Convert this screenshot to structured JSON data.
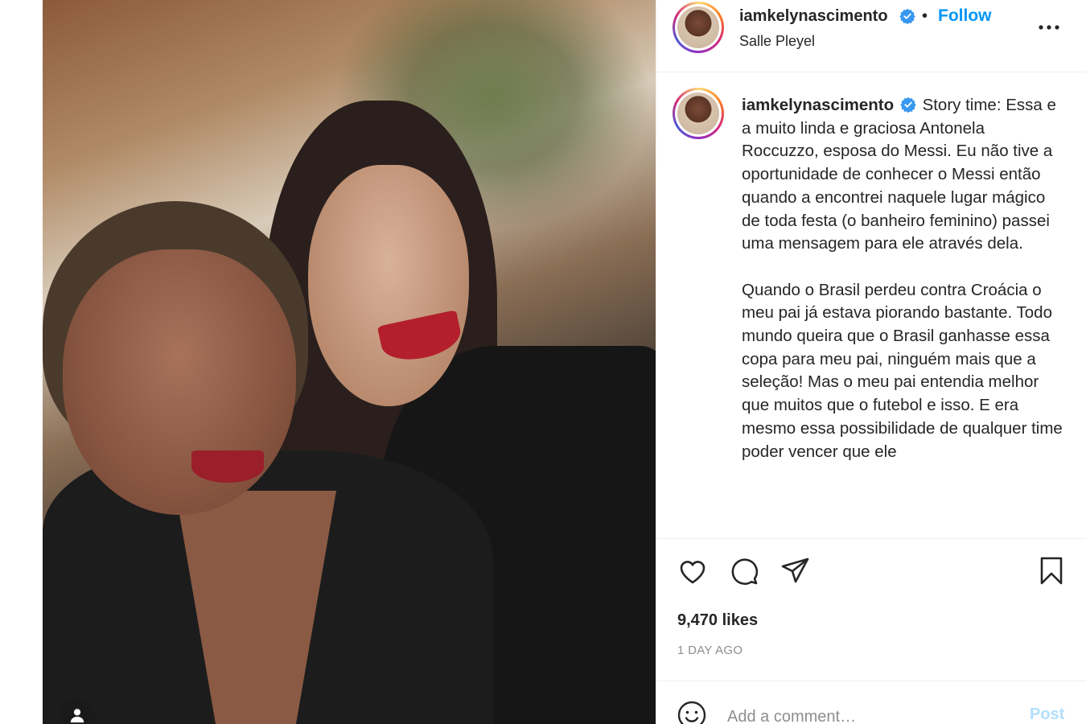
{
  "post": {
    "username": "iamkelynascimento",
    "verified": true,
    "follow_label": "Follow",
    "dot": "•",
    "location": "Salle Pleyel"
  },
  "caption": {
    "username": "iamkelynascimento",
    "paragraph_1": "Story time: Essa e a muito linda e graciosa Antonela Roccuzzo, esposa do Messi. Eu não tive a oportunidade de conhecer o Messi então quando a encontrei naquele lugar mágico de toda festa (o banheiro feminino) passei uma mensagem para ele através dela.",
    "paragraph_2": "Quando o Brasil perdeu contra Croácia o meu pai já estava piorando bastante. Todo mundo queira que o Brasil ganhasse essa copa para meu pai, ninguém mais que a seleção! Mas o meu pai entendia melhor que muitos que o futebol e isso. E era mesmo essa possibilidade de qualquer time poder vencer que ele"
  },
  "actions": {
    "like_icon": "heart-icon",
    "comment_icon": "comment-bubble-icon",
    "share_icon": "paper-plane-icon",
    "save_icon": "bookmark-icon"
  },
  "stats": {
    "likes": "9,470 likes",
    "time": "1 DAY AGO"
  },
  "comment": {
    "placeholder": "Add a comment…",
    "post_label": "Post"
  },
  "colors": {
    "accent": "#0095f6",
    "verified": "#3897f0",
    "post_disabled": "#b2dffc",
    "muted": "#8e8e8e"
  }
}
